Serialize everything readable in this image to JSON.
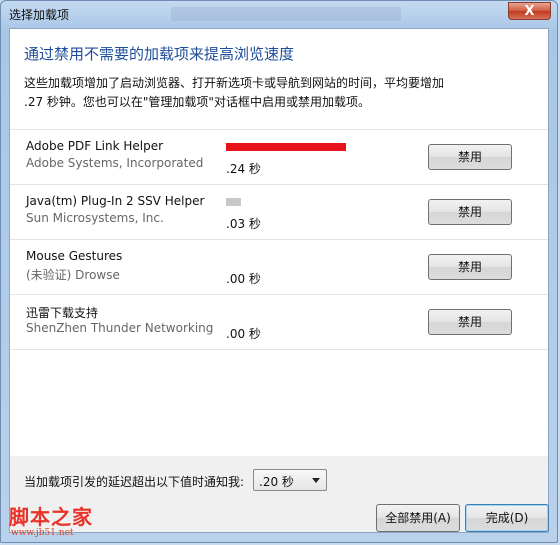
{
  "window": {
    "title": "选择加载项",
    "close_glyph": "X"
  },
  "heading": "通过禁用不需要的加载项来提高浏览速度",
  "description": "这些加载项增加了启动浏览器、打开新选项卡或导航到网站的时间，平均要增加 .27 秒钟。您也可以在\"管理加载项\"对话框中启用或禁用加载项。",
  "addons": [
    {
      "name": "Adobe PDF Link Helper",
      "publisher": "Adobe Systems, Incorporated",
      "time": ".24 秒",
      "load_fraction": 1.0,
      "bar_color": "#e8141c",
      "button": "禁用"
    },
    {
      "name": "Java(tm) Plug-In 2 SSV Helper",
      "publisher": "Sun Microsystems, Inc.",
      "time": ".03 秒",
      "load_fraction": 0.125,
      "bar_color": "#c8c8c8",
      "button": "禁用"
    },
    {
      "name": "Mouse Gestures",
      "publisher": "(未验证) Drowse",
      "time": ".00 秒",
      "load_fraction": 0,
      "bar_color": "#c8c8c8",
      "button": "禁用"
    },
    {
      "name": "迅雷下载支持",
      "publisher": "ShenZhen Thunder Networking T",
      "time": ".00 秒",
      "load_fraction": 0,
      "bar_color": "#c8c8c8",
      "button": "禁用"
    }
  ],
  "notify": {
    "label": "当加载项引发的延迟超出以下值时通知我:",
    "threshold": ".20 秒"
  },
  "footer": {
    "disable_all": "全部禁用(A)",
    "done": "完成(D)"
  },
  "watermark": {
    "text": "脚本之家",
    "url": "www.jb51.net"
  }
}
